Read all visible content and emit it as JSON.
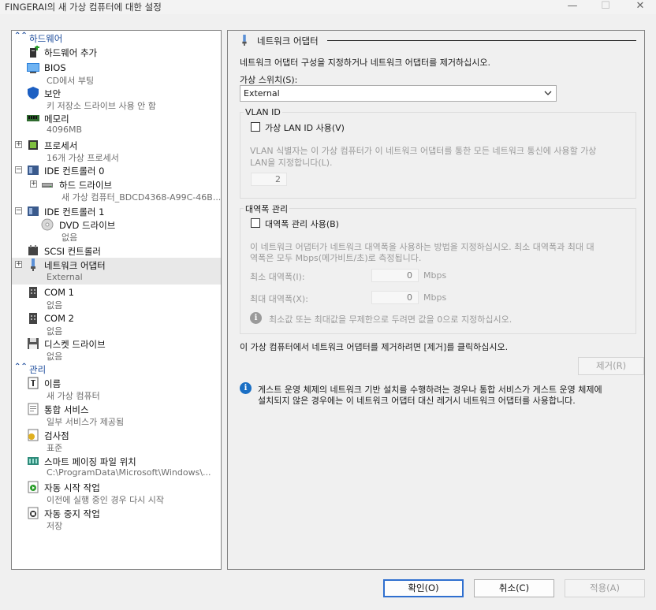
{
  "window": {
    "title": "FINGERAI의 새 가상 컴퓨터에 대한 설정",
    "minimize": "—",
    "maximize": "☐",
    "close": "✕"
  },
  "tree": {
    "hardware_header": "하드웨어",
    "management_header": "관리",
    "add_hardware": "하드웨어 추가",
    "bios": {
      "title": "BIOS",
      "sub": "CD에서 부팅"
    },
    "security": {
      "title": "보안",
      "sub": "키 저장소 드라이브 사용 안 함"
    },
    "memory": {
      "title": "메모리",
      "sub": "4096MB"
    },
    "processor": {
      "title": "프로세서",
      "sub": "16개 가상 프로세서"
    },
    "ide0": {
      "title": "IDE 컨트롤러 0"
    },
    "hdd": {
      "title": "하드 드라이브",
      "sub": "새 가상 컴퓨터_BDCD4368-A99C-46B..."
    },
    "ide1": {
      "title": "IDE 컨트롤러 1"
    },
    "dvd": {
      "title": "DVD 드라이브",
      "sub": "없음"
    },
    "scsi": {
      "title": "SCSI 컨트롤러"
    },
    "nic": {
      "title": "네트워크 어댑터",
      "sub": "External"
    },
    "com1": {
      "title": "COM 1",
      "sub": "없음"
    },
    "com2": {
      "title": "COM 2",
      "sub": "없음"
    },
    "floppy": {
      "title": "디스켓 드라이브",
      "sub": "없음"
    },
    "name": {
      "title": "이름",
      "sub": "새 가상 컴퓨터"
    },
    "integration": {
      "title": "통합 서비스",
      "sub": "일부 서비스가 제공됨"
    },
    "checkpoints": {
      "title": "검사점",
      "sub": "표준"
    },
    "paging": {
      "title": "스마트 페이징 파일 위치",
      "sub": "C:\\ProgramData\\Microsoft\\Windows\\..."
    },
    "autostart": {
      "title": "자동 시작 작업",
      "sub": "이전에 실행 중인 경우 다시 시작"
    },
    "autostop": {
      "title": "자동 중지 작업",
      "sub": "저장"
    }
  },
  "panel": {
    "header": "네트워크 어댑터",
    "description": "네트워크 어댑터 구성을 지정하거나 네트워크 어댑터를 제거하십시오.",
    "switch_label": "가상 스위치(S):",
    "switch_value": "External",
    "vlan": {
      "legend": "VLAN ID",
      "checkbox_label": "가상 LAN ID 사용(V)",
      "checked": false,
      "desc_line1": "VLAN 식별자는 이 가상 컴퓨터가 이 네트워크 어댑터를 통한 모든 네트워크 통신에 사용할 가상",
      "desc_line2": "LAN을 지정합니다(L).",
      "value": "2"
    },
    "bandwidth": {
      "legend": "대역폭 관리",
      "checkbox_label": "대역폭 관리 사용(B)",
      "checked": false,
      "desc_line1": "이 네트워크 어댑터가 네트워크 대역폭을 사용하는 방법을 지정하십시오. 최소 대역폭과 최대 대",
      "desc_line2": "역폭은 모두 Mbps(메가비트/초)로 측정됩니다.",
      "min_label": "최소 대역폭(I):",
      "min_value": "0",
      "max_label": "최대 대역폭(X):",
      "max_value": "0",
      "unit": "Mbps",
      "note": "최소값 또는 최대값을 무제한으로 두려면 값을 0으로 지정하십시오."
    },
    "remove_text": "이 가상 컴퓨터에서 네트워크 어댑터를 제거하려면 [제거]를 클릭하십시오.",
    "remove_button": "제거(R)",
    "info_line1": "게스트 운영 체제의 네트워크 기반 설치를 수행하려는 경우나 통합 서비스가 게스트 운영 체제에",
    "info_line2": "설치되지 않은 경우에는 이 네트워크 어댑터 대신 레거시 네트워크 어댑터를 사용합니다."
  },
  "buttons": {
    "ok": "확인(O)",
    "cancel": "취소(C)",
    "apply": "적용(A)"
  },
  "colors": {
    "accent": "#1e4d9c",
    "selection": "#e8e8e8",
    "info": "#1a6fc4"
  }
}
